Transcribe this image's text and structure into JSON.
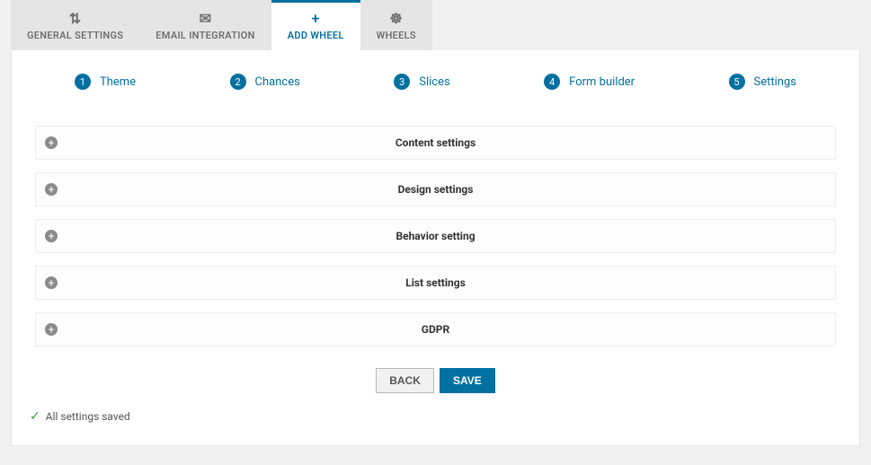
{
  "tabs": [
    {
      "label": "GENERAL SETTINGS",
      "icon": "⇅",
      "active": false
    },
    {
      "label": "EMAIL INTEGRATION",
      "icon": "✉",
      "active": false
    },
    {
      "label": "ADD WHEEL",
      "icon": "+",
      "active": true
    },
    {
      "label": "WHEELS",
      "icon": "☸",
      "active": false
    }
  ],
  "steps": [
    {
      "num": "1",
      "label": "Theme"
    },
    {
      "num": "2",
      "label": "Chances"
    },
    {
      "num": "3",
      "label": "Slices"
    },
    {
      "num": "4",
      "label": "Form builder"
    },
    {
      "num": "5",
      "label": "Settings"
    }
  ],
  "accordion": [
    {
      "title": "Content settings"
    },
    {
      "title": "Design settings"
    },
    {
      "title": "Behavior setting"
    },
    {
      "title": "List settings"
    },
    {
      "title": "GDPR"
    }
  ],
  "buttons": {
    "back": "BACK",
    "save": "SAVE"
  },
  "status": {
    "text": "All settings saved"
  },
  "expand_glyph": "+"
}
